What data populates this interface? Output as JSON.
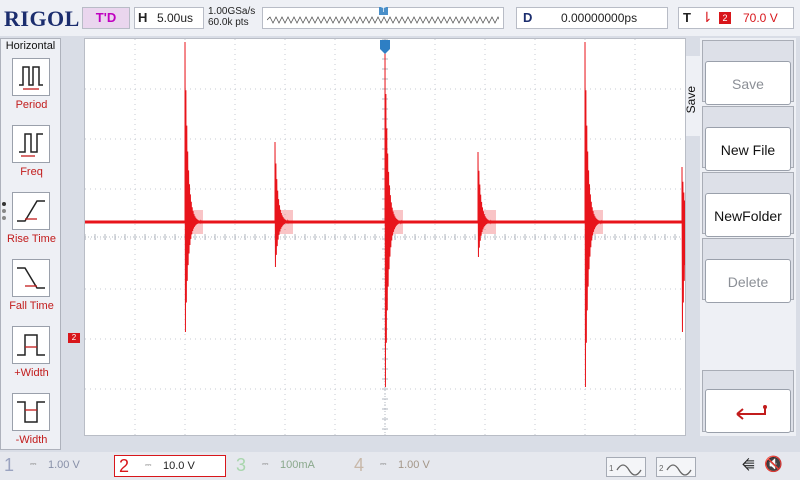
{
  "brand": "RIGOL",
  "top": {
    "run_state": "T'D",
    "horizontal_key": "H",
    "timebase": "5.00us",
    "sample_rate": "1.00GSa/s",
    "memory_depth": "60.0k pts",
    "trigger_pos_marker": "T",
    "delay_key": "D",
    "delay_value": "0.00000000ps",
    "trigger_key": "T",
    "trigger_edge_icon": "falling-edge-icon",
    "trigger_source": "2",
    "trigger_level": "70.0 V"
  },
  "left_menu": {
    "title": "Horizontal",
    "items": [
      {
        "label": "Period",
        "icon": "period-icon"
      },
      {
        "label": "Freq",
        "icon": "frequency-icon"
      },
      {
        "label": "Rise Time",
        "icon": "rise-time-icon"
      },
      {
        "label": "Fall Time",
        "icon": "fall-time-icon"
      },
      {
        "label": "+Width",
        "icon": "positive-width-icon"
      },
      {
        "label": "-Width",
        "icon": "negative-width-icon"
      }
    ]
  },
  "screen": {
    "channel_marker": "2",
    "trigger_marker": "T",
    "trace_color": "#e8141b"
  },
  "right_menu": {
    "tab_label": "Save",
    "keys": [
      {
        "label": "Save",
        "enabled": false
      },
      {
        "label": "New File",
        "enabled": true
      },
      {
        "label": "NewFolder",
        "enabled": true
      },
      {
        "label": "Delete",
        "enabled": false
      },
      {
        "label": "",
        "icon": "return-arrow-icon"
      }
    ]
  },
  "channels": [
    {
      "num": "1",
      "scale": "1.00 V",
      "color": "#9aa3c0",
      "active": false
    },
    {
      "num": "2",
      "scale": "10.0 V",
      "color": "#d8161b",
      "active": true
    },
    {
      "num": "3",
      "scale": "100mA",
      "color": "#a9d6ad",
      "active": false
    },
    {
      "num": "4",
      "scale": "1.00 V",
      "color": "#c8b8a9",
      "active": false
    }
  ],
  "math": [
    {
      "num": "1",
      "icon": "math-wave-icon"
    },
    {
      "num": "2",
      "icon": "math-wave-icon"
    }
  ],
  "status_icons": [
    "usb-icon",
    "speaker-mute-icon"
  ]
}
